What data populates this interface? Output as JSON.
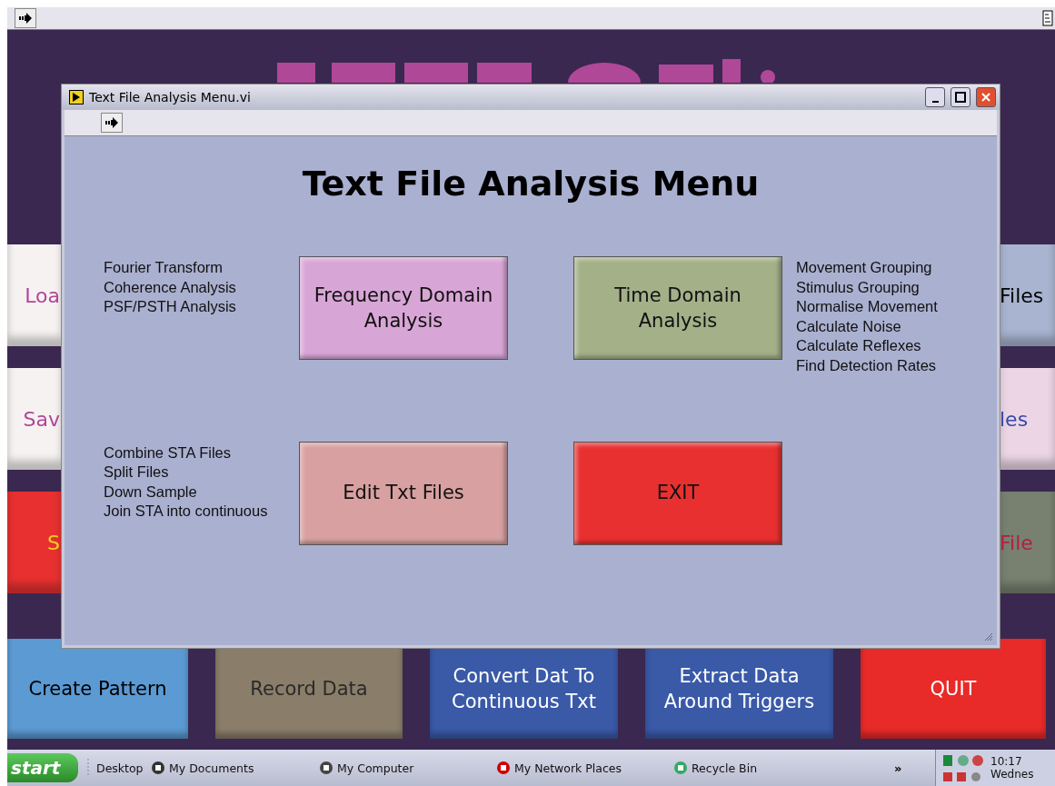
{
  "background_app": {
    "left_buttons": [
      {
        "label": "Loa",
        "color": "#f6f2f2"
      },
      {
        "label": "Sav",
        "color": "#f6f2f2"
      },
      {
        "label": "S",
        "color": "#e83030"
      }
    ],
    "right_buttons": [
      {
        "label": "Files",
        "color": "#a8b4d0"
      },
      {
        "label": "les",
        "color": "#ecd6e6"
      },
      {
        "label": "File",
        "color": "#788070"
      }
    ],
    "bottom_buttons": [
      {
        "label": "Create Pattern",
        "color": "#5b9ad2"
      },
      {
        "label": "Record Data",
        "color": "#8a7e6a"
      },
      {
        "label": "Convert Dat To Continuous Txt",
        "color": "#3a5aa8"
      },
      {
        "label": "Extract Data Around Triggers",
        "color": "#3a5aa8"
      },
      {
        "label": "QUIT",
        "color": "#e82a28"
      }
    ]
  },
  "dialog": {
    "title": "Text File Analysis Menu.vi",
    "heading": "Text File Analysis Menu",
    "sections": [
      {
        "items": [
          "Fourier Transform",
          "Coherence Analysis",
          "PSF/PSTH Analysis"
        ],
        "button": {
          "label": "Frequency Domain Analysis",
          "color": "#d8a6d6"
        },
        "kind": "leftlist"
      },
      {
        "items": [
          "Movement Grouping",
          "Stimulus Grouping",
          "Normalise Movement",
          "Calculate Noise",
          "Calculate Reflexes",
          "Find Detection Rates"
        ],
        "button": {
          "label": "Time Domain Analysis",
          "color": "#a4b088"
        },
        "kind": "rightlist"
      },
      {
        "items": [
          "Combine STA Files",
          "Split Files",
          "Down Sample",
          "Join STA into continuous"
        ],
        "button": {
          "label": "Edit Txt Files",
          "color": "#d8a0a0"
        },
        "kind": "leftlist"
      },
      {
        "button": {
          "label": "EXIT",
          "color": "#e83030"
        },
        "kind": "rightlist"
      }
    ]
  },
  "taskbar": {
    "start": "start",
    "items": [
      "Desktop",
      "My Documents",
      "My Computer",
      "My Network Places",
      "Recycle Bin"
    ],
    "overflow": "»",
    "clock": "10:17",
    "date": "Wednes"
  }
}
